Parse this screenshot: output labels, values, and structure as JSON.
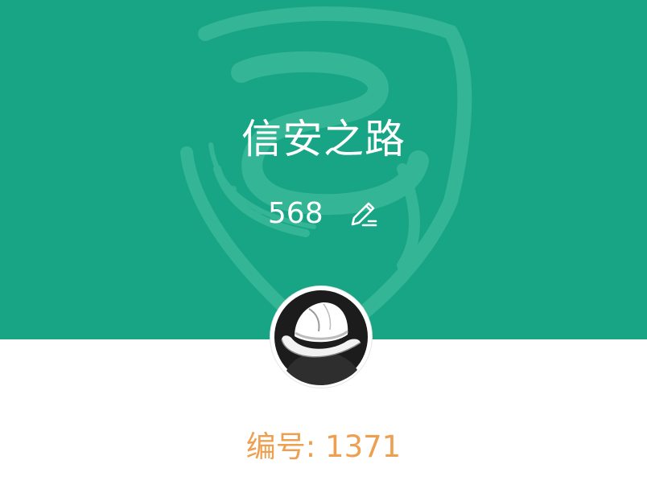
{
  "profile": {
    "name": "信安之路",
    "count": "568",
    "number_label": "编号: 1371"
  },
  "icons": {
    "edit": "pencil-edit-icon",
    "avatar": "hat-avatar",
    "watermark": "shield-logo-watermark"
  },
  "colors": {
    "banner": "#18a585",
    "watermark": "#3bbd9b",
    "number_text": "#ee9f4f",
    "title_text": "#ffffff"
  }
}
